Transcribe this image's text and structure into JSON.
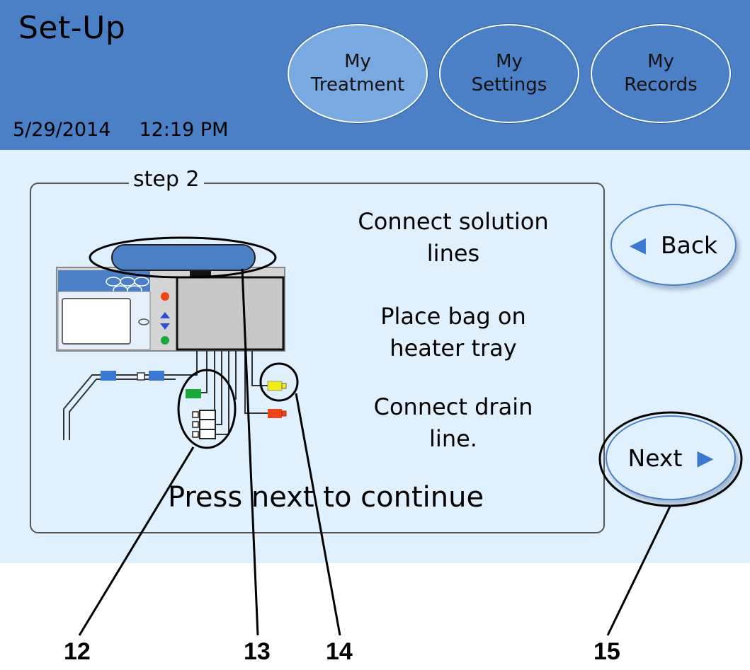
{
  "header": {
    "title": "Set-Up",
    "date": "5/29/2014",
    "time": "12:19 PM",
    "tabs": [
      {
        "label_line1": "My",
        "label_line2": "Treatment",
        "active": true
      },
      {
        "label_line1": "My",
        "label_line2": "Settings",
        "active": false
      },
      {
        "label_line1": "My",
        "label_line2": "Records",
        "active": false
      }
    ]
  },
  "panel": {
    "step_label": "step 2",
    "instructions": [
      {
        "line1": "Connect solution",
        "line2": "lines"
      },
      {
        "line1": "Place bag on",
        "line2": "heater tray"
      },
      {
        "line1": "Connect drain",
        "line2": "line."
      }
    ],
    "press_next": "Press next to continue"
  },
  "buttons": {
    "back_label": "Back",
    "next_label": "Next"
  },
  "callouts": [
    "12",
    "13",
    "14",
    "15"
  ],
  "colors": {
    "header_bg": "#4b80c6",
    "active_tab": "#79a9e0",
    "content_bg": "#e0f1fd",
    "connector_green": "#1aa83a",
    "connector_yellow": "#f2ee12",
    "connector_red": "#ee4418",
    "arrow_blue": "#3a78d2"
  }
}
